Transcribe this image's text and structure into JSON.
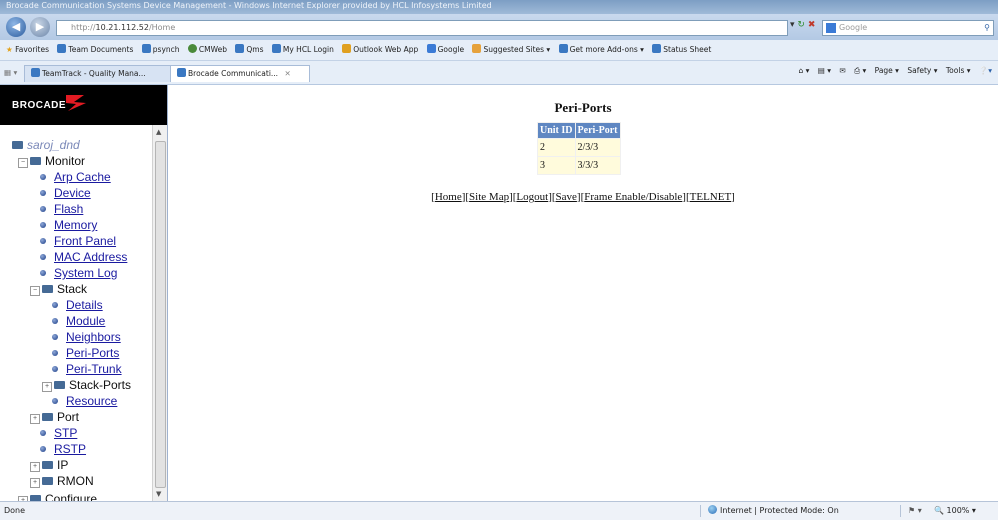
{
  "window": {
    "title": "Brocade Communication Systems Device Management - Windows Internet Explorer provided by HCL Infosystems Limited"
  },
  "address_bar": {
    "prefix": "http://",
    "host": "10.21.112.52",
    "path": "/Home"
  },
  "search": {
    "placeholder": "Google"
  },
  "favorites": {
    "label": "Favorites",
    "items": [
      "Team Documents",
      "psynch",
      "CMWeb",
      "Qms",
      "My HCL Login",
      "Outlook Web App",
      "Google",
      "Suggested Sites ▾",
      "Get more Add-ons ▾",
      "Status Sheet"
    ]
  },
  "tabs": [
    {
      "label": "TeamTrack - Quality Mana..."
    },
    {
      "label": "Brocade Communicati..."
    }
  ],
  "command_bar": {
    "page": "Page ▾",
    "safety": "Safety ▾",
    "tools": "Tools ▾"
  },
  "logo": {
    "text": "BROCADE"
  },
  "tree": {
    "user": "saroj_dnd",
    "monitor": "Monitor",
    "monitor_items": [
      "Arp Cache",
      "Device",
      "Flash",
      "Memory",
      "Front Panel",
      "MAC Address",
      "System Log"
    ],
    "stack": "Stack",
    "stack_items": [
      "Details",
      "Module",
      "Neighbors",
      "Peri-Ports",
      "Peri-Trunk"
    ],
    "stack_ports": "Stack-Ports",
    "resource": "Resource",
    "port": "Port",
    "stp": "STP",
    "rstp": "RSTP",
    "ip": "IP",
    "rmon": "RMON",
    "configure": "Configure"
  },
  "main": {
    "title": "Peri-Ports",
    "table": {
      "headers": [
        "Unit ID",
        "Peri-Port"
      ],
      "rows": [
        [
          "2",
          "2/3/3"
        ],
        [
          "3",
          "3/3/3"
        ]
      ]
    },
    "links": [
      "Home",
      "Site Map",
      "Logout",
      "Save",
      "Frame Enable/Disable",
      "TELNET"
    ]
  },
  "status": {
    "left": "Done",
    "zone": "Internet | Protected Mode: On",
    "zoom": "100%"
  }
}
